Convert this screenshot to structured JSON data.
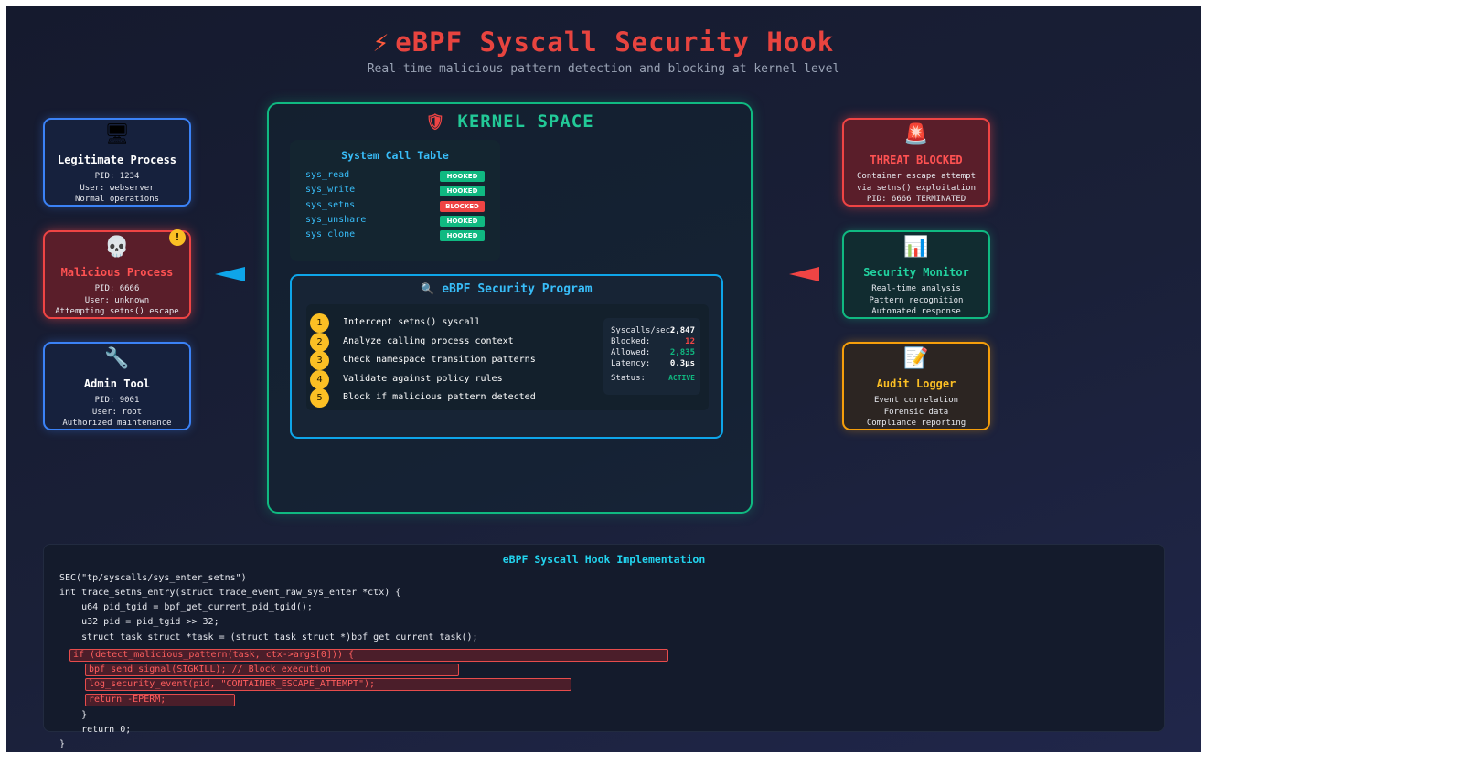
{
  "header": {
    "title_icon": "lightning-bolt",
    "title": "eBPF Syscall Security Hook",
    "subtitle": "Real-time malicious pattern detection and blocking at kernel level"
  },
  "processes": [
    {
      "icon": "monitor-icon",
      "glyph": "🖥",
      "title": "Legitimate Process",
      "lines": [
        "PID: 1234",
        "User: webserver",
        "Normal operations"
      ],
      "theme": "blue"
    },
    {
      "icon": "skull-icon",
      "glyph": "💀",
      "title": "Malicious Process",
      "lines": [
        "PID: 6666",
        "User: unknown",
        "Attempting setns() escape"
      ],
      "theme": "red",
      "badge": "!"
    },
    {
      "icon": "wrench-icon",
      "glyph": "🔧",
      "title": "Admin Tool",
      "lines": [
        "PID: 9001",
        "User: root",
        "Authorized maintenance"
      ],
      "theme": "blue"
    }
  ],
  "monitors": [
    {
      "icon": "siren-icon",
      "glyph": "🚨",
      "title": "THREAT BLOCKED",
      "lines": [
        "Container escape attempt",
        "via setns() exploitation",
        "PID: 6666 TERMINATED"
      ],
      "theme": "red"
    },
    {
      "icon": "bar-chart-icon",
      "glyph": "📊",
      "title": "Security Monitor",
      "lines": [
        "Real-time analysis",
        "Pattern recognition",
        "Automated response"
      ],
      "theme": "green"
    },
    {
      "icon": "memo-icon",
      "glyph": "📝",
      "title": "Audit Logger",
      "lines": [
        "Event correlation",
        "Forensic data",
        "Compliance reporting"
      ],
      "theme": "orange"
    }
  ],
  "kernel": {
    "icon": "shield-icon",
    "title": "KERNEL SPACE",
    "syscall_table": {
      "title": "System Call Table",
      "rows": [
        {
          "name": "sys_read",
          "status": "HOOKED",
          "color": "#10b981"
        },
        {
          "name": "sys_write",
          "status": "HOOKED",
          "color": "#10b981"
        },
        {
          "name": "sys_setns",
          "status": "BLOCKED",
          "color": "#ef4444"
        },
        {
          "name": "sys_unshare",
          "status": "HOOKED",
          "color": "#10b981"
        },
        {
          "name": "sys_clone",
          "status": "HOOKED",
          "color": "#10b981"
        }
      ]
    },
    "program": {
      "icon": "magnifier-icon",
      "title": "eBPF Security Program",
      "steps": [
        {
          "num": "1",
          "text": "Intercept setns() syscall"
        },
        {
          "num": "2",
          "text": "Analyze calling process context"
        },
        {
          "num": "3",
          "text": "Check namespace transition patterns"
        },
        {
          "num": "4",
          "text": "Validate against policy rules"
        },
        {
          "num": "5",
          "text": "Block if malicious pattern detected"
        }
      ],
      "stats": [
        {
          "label": "Syscalls/sec:",
          "value": "2,847",
          "color": "#ffffff"
        },
        {
          "label": "Blocked:",
          "value": "12",
          "color": "#ef4444"
        },
        {
          "label": "Allowed:",
          "value": "2,835",
          "color": "#10b981"
        },
        {
          "label": "Latency:",
          "value": "0.3μs",
          "color": "#ffffff"
        },
        {
          "label": "Status:",
          "value": "ACTIVE",
          "color": "#10b981"
        }
      ]
    }
  },
  "code": {
    "title": "eBPF Syscall Hook Implementation",
    "lines": [
      "SEC(\"tp/syscalls/sys_enter_setns\")",
      "int trace_setns_entry(struct trace_event_raw_sys_enter *ctx) {",
      "    u64 pid_tgid = bpf_get_current_pid_tgid();",
      "    u32 pid = pid_tgid >> 32;",
      "    struct task_struct *task = (struct task_struct *)bpf_get_current_task();"
    ],
    "highlighted": [
      "if (detect_malicious_pattern(task, ctx->args[0])) {",
      "bpf_send_signal(SIGKILL); // Block execution",
      "log_security_event(pid, \"CONTAINER_ESCAPE_ATTEMPT\");",
      "return -EPERM;"
    ],
    "tail": [
      "    }",
      "    return 0;",
      "}"
    ]
  }
}
